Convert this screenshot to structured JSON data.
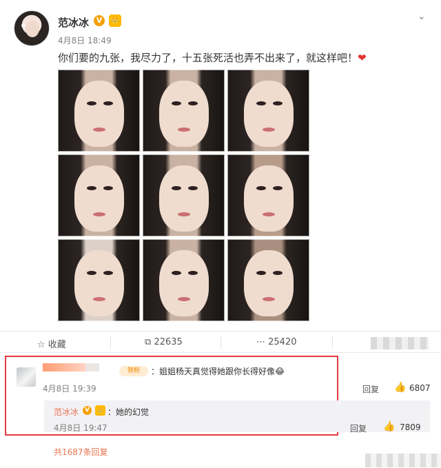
{
  "post": {
    "username": "范冰冰",
    "verified_badge": "V",
    "member_badge": "👑",
    "time": "4月8日 18:49",
    "text": "你们要的九张，我尽力了，十五张死活也弄不出来了，就这样吧！",
    "heart": "❤",
    "menu_icon": "chevron-down-icon",
    "photo_count": 9
  },
  "actions": {
    "favorite_label": "收藏",
    "repost_count": "22635",
    "comment_count": "25420"
  },
  "comment": {
    "fan_badge": "铁粉",
    "text": "：姐姐杨天真觉得她跟你长得好像😂",
    "time": "4月8日 19:39",
    "reply_label": "回复",
    "like_count": "6807"
  },
  "reply": {
    "username": "范冰冰",
    "verified_badge": "V",
    "member_badge": "👑",
    "text": "：她的幻觉",
    "time": "4月8日 19:47",
    "reply_label": "回复",
    "like_count": "7809"
  },
  "more_replies": "共1687条回复",
  "colors": {
    "accent_orange": "#eb7350",
    "verified_gold": "#f5a000",
    "highlight_red": "#e4393c"
  }
}
